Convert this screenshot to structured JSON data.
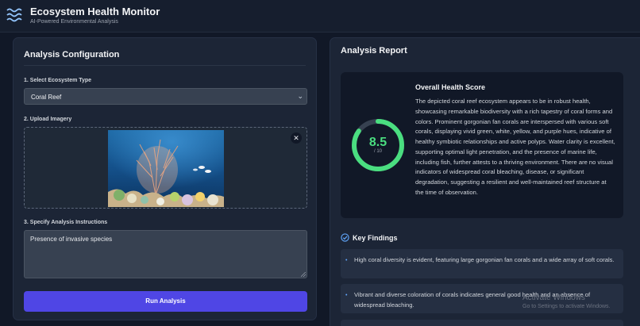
{
  "header": {
    "title": "Ecosystem Health Monitor",
    "subtitle": "AI-Powered Environmental Analysis",
    "logo_icon": "waves-icon"
  },
  "config": {
    "title": "Analysis Configuration",
    "ecosystem_label": "1. Select Ecosystem Type",
    "ecosystem_value": "Coral Reef",
    "upload_label": "2. Upload Imagery",
    "instructions_label": "3. Specify Analysis Instructions",
    "instructions_value": "Presence of invasive species",
    "run_label": "Run Analysis"
  },
  "report": {
    "title": "Analysis Report",
    "score_title": "Overall Health Score",
    "score_value": "8.5",
    "score_max": "/ 10",
    "score_fraction": 0.85,
    "score_color": "#4ade80",
    "summary": "The depicted coral reef ecosystem appears to be in robust health, showcasing remarkable biodiversity with a rich tapestry of coral forms and colors. Prominent gorgonian fan corals are interspersed with various soft corals, displaying vivid green, white, yellow, and purple hues, indicative of healthy symbiotic relationships and active polyps. Water clarity is excellent, supporting optimal light penetration, and the presence of marine life, including fish, further attests to a thriving environment. There are no visual indicators of widespread coral bleaching, disease, or significant degradation, suggesting a resilient and well-maintained reef structure at the time of observation.",
    "findings_title": "Key Findings",
    "findings": [
      "High coral diversity is evident, featuring large gorgonian fan corals and a wide array of soft corals.",
      "Vibrant and diverse coloration of corals indicates general good health and an absence of widespread bleaching."
    ]
  },
  "watermark": {
    "title": "Activate Windows",
    "subtitle": "Go to Settings to activate Windows."
  },
  "colors": {
    "accent": "#4f46e5",
    "background": "#111827",
    "panel": "#1c2536"
  }
}
